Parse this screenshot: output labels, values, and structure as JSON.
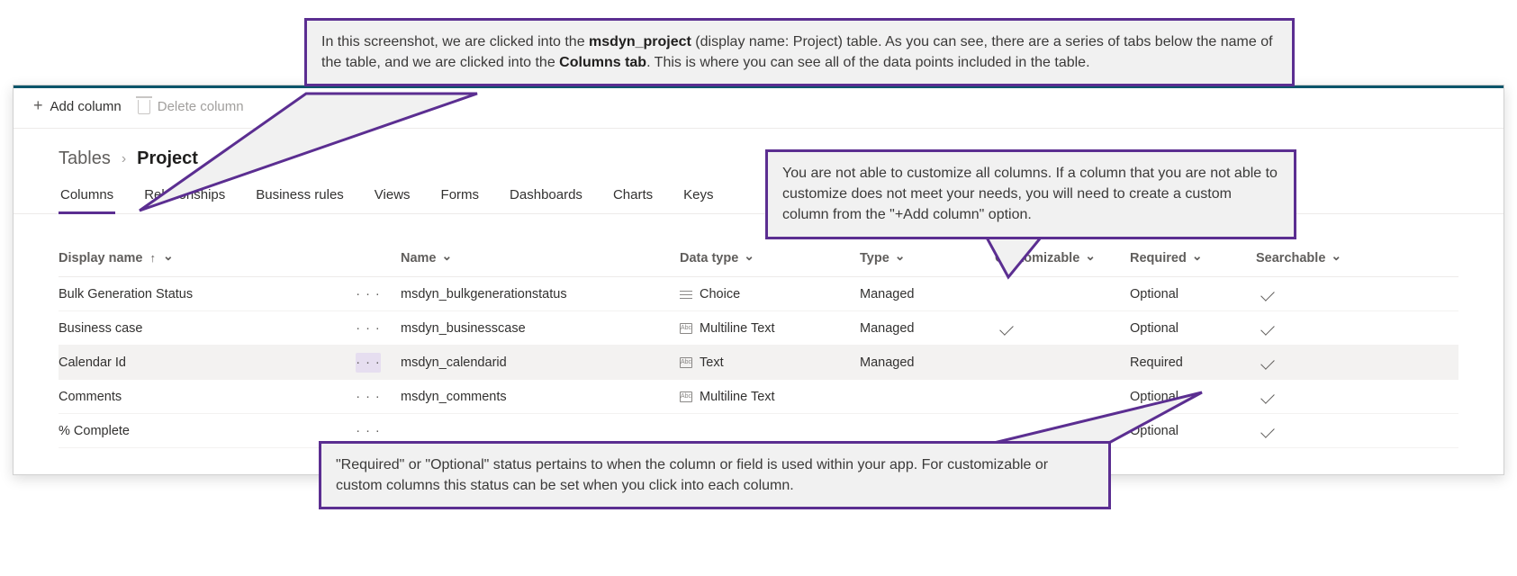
{
  "toolbar": {
    "add_column_label": "Add column",
    "delete_column_label": "Delete column"
  },
  "breadcrumb": {
    "root": "Tables",
    "current": "Project"
  },
  "tabs": [
    {
      "label": "Columns",
      "active": true
    },
    {
      "label": "Relationships",
      "active": false
    },
    {
      "label": "Business rules",
      "active": false
    },
    {
      "label": "Views",
      "active": false
    },
    {
      "label": "Forms",
      "active": false
    },
    {
      "label": "Dashboards",
      "active": false
    },
    {
      "label": "Charts",
      "active": false
    },
    {
      "label": "Keys",
      "active": false
    }
  ],
  "columns_header": {
    "display_name": "Display name",
    "name": "Name",
    "data_type": "Data type",
    "type": "Type",
    "customizable": "Customizable",
    "required": "Required",
    "searchable": "Searchable"
  },
  "rows": [
    {
      "display_name": "Bulk Generation Status",
      "name": "msdyn_bulkgenerationstatus",
      "data_type": "Choice",
      "dt_icon": "lines",
      "type": "Managed",
      "customizable": false,
      "required": "Optional",
      "searchable": true,
      "selected": false
    },
    {
      "display_name": "Business case",
      "name": "msdyn_businesscase",
      "data_type": "Multiline Text",
      "dt_icon": "box",
      "type": "Managed",
      "customizable": true,
      "required": "Optional",
      "searchable": true,
      "selected": false
    },
    {
      "display_name": "Calendar Id",
      "name": "msdyn_calendarid",
      "data_type": "Text",
      "dt_icon": "box",
      "type": "Managed",
      "customizable": false,
      "required": "Required",
      "searchable": true,
      "selected": true
    },
    {
      "display_name": "Comments",
      "name": "msdyn_comments",
      "data_type": "Multiline Text",
      "dt_icon": "box",
      "type": "",
      "customizable": false,
      "required": "Optional",
      "searchable": true,
      "selected": false
    },
    {
      "display_name": "% Complete",
      "name": "",
      "data_type": "",
      "dt_icon": "",
      "type": "",
      "customizable": false,
      "required": "Optional",
      "searchable": true,
      "selected": false
    }
  ],
  "callouts": {
    "top": {
      "pre": "In this screenshot, we are clicked into the ",
      "bold1": "msdyn_project",
      "mid": " (display name: Project) table. As you can see, there are a series of tabs below the name of the table, and we are clicked into the ",
      "bold2": "Columns tab",
      "post": ". This is where you can see all of the data points included in the table."
    },
    "right": "You are not able to customize all columns. If a column that you are not able to customize does not meet your needs, you will need to create a custom column from the \"+Add column\" option.",
    "bottom": "\"Required\" or \"Optional\" status pertains to when the column or field is used within your app. For customizable or custom columns this status can be set when you click into each column."
  }
}
